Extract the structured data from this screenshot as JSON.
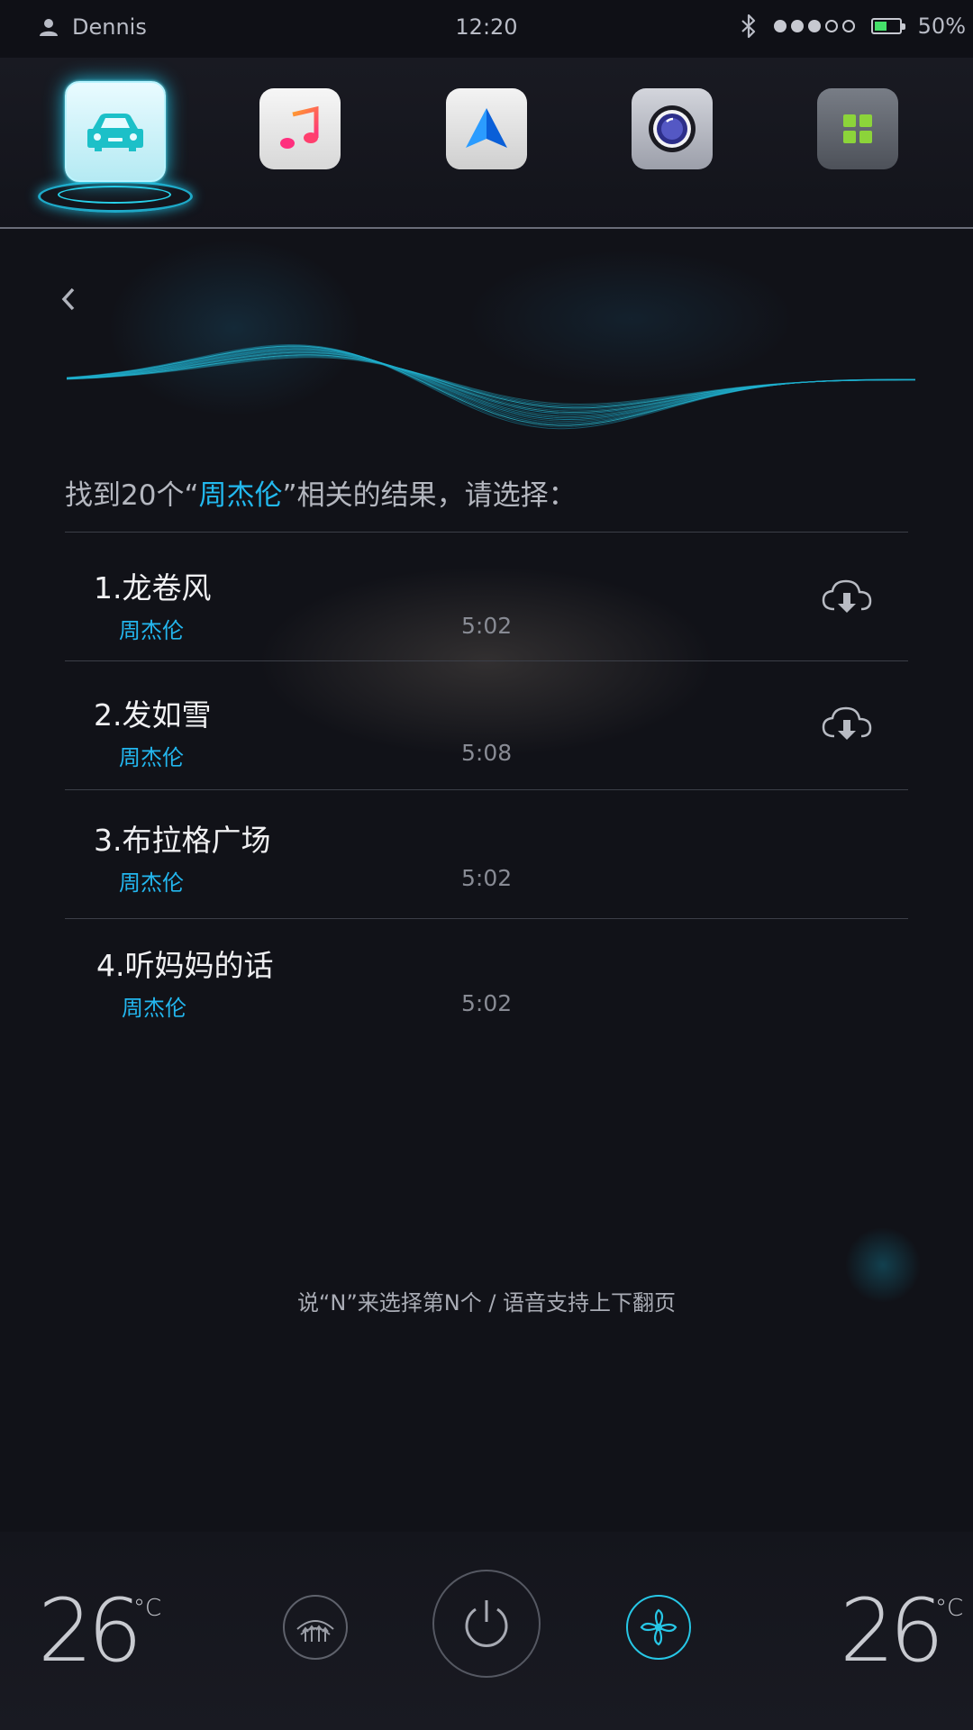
{
  "status_bar": {
    "user_name": "Dennis",
    "time": "12:20",
    "signal_strength": 3,
    "signal_max": 5,
    "battery_text": "50%",
    "battery_level": 0.5,
    "battery_color": "#45e06a"
  },
  "dock": {
    "apps": [
      {
        "name": "car",
        "icon": "car-icon",
        "active": true
      },
      {
        "name": "music",
        "icon": "music-note-icon",
        "active": false
      },
      {
        "name": "navigation",
        "icon": "navigation-arrow-icon",
        "active": false
      },
      {
        "name": "camera",
        "icon": "camera-lens-icon",
        "active": false
      },
      {
        "name": "apps",
        "icon": "apps-grid-icon",
        "active": false
      }
    ]
  },
  "voice": {
    "prompt_prefix": "找到20个“",
    "keyword": "周杰伦",
    "prompt_suffix": "”相关的结果，请选择：",
    "accent_color": "#22b9ef"
  },
  "results": [
    {
      "title": "1.龙卷风",
      "artist": "周杰伦",
      "duration": "5:02",
      "downloadable": true
    },
    {
      "title": "2.发如雪",
      "artist": "周杰伦",
      "duration": "5:08",
      "downloadable": true
    },
    {
      "title": "3.布拉格广场",
      "artist": "周杰伦",
      "duration": "5:02",
      "downloadable": false
    },
    {
      "title": "4.听妈妈的话",
      "artist": "周杰伦",
      "duration": "5:02",
      "downloadable": false
    }
  ],
  "hint": "说“N”来选择第N个 / 语音支持上下翻页",
  "climate": {
    "left_temp": "26",
    "right_temp": "26",
    "unit": "°C",
    "fan_color": "#27c7e6"
  }
}
